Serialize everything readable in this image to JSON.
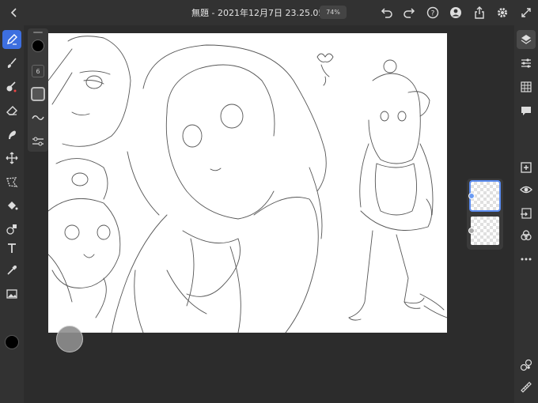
{
  "header": {
    "title": "無題 - 2021年12月7日 23.25.05 *",
    "zoom": "74%"
  },
  "tool_props": {
    "brush_size": "6"
  },
  "colors": {
    "accent": "#3d6fe0",
    "current_color": "#000000"
  },
  "icons": {
    "left": [
      "pencil-icon",
      "brush-icon",
      "fill-brush-icon",
      "eraser-icon",
      "smudge-icon",
      "move-icon",
      "lasso-icon",
      "paint-bucket-icon",
      "shapes-icon",
      "text-icon",
      "eyedropper-icon",
      "image-icon"
    ],
    "right": [
      "layers-icon",
      "adjustments-icon",
      "grid-icon",
      "comment-icon",
      "add-layer-icon",
      "visibility-icon",
      "import-icon",
      "blend-icon",
      "more-icon",
      "shapes-icon",
      "ruler-icon"
    ]
  }
}
